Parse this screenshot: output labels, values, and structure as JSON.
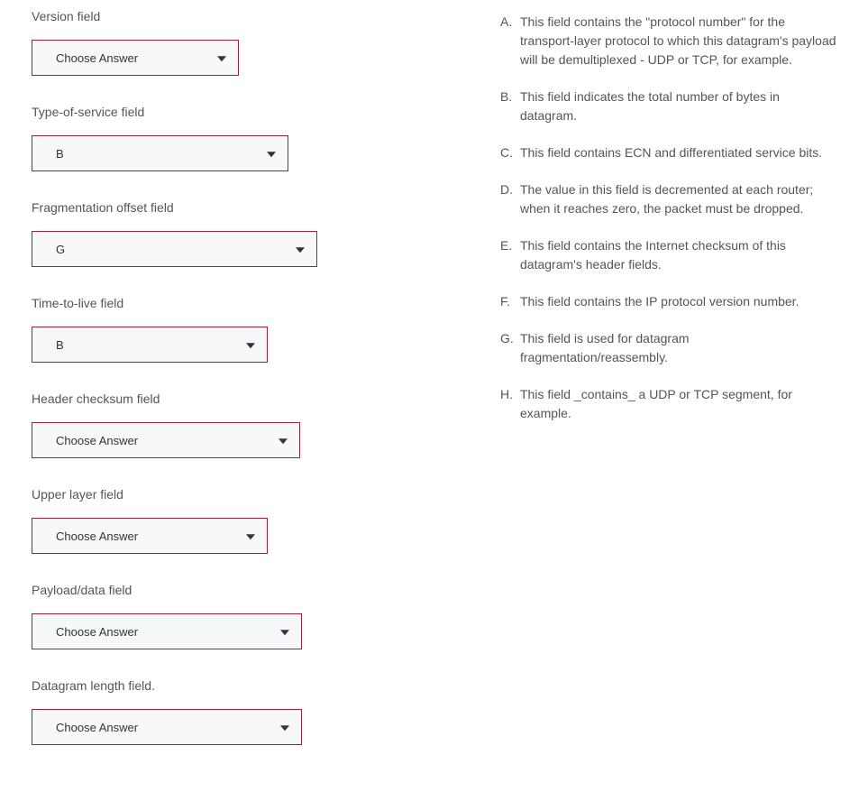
{
  "fields": [
    {
      "label": "Version field",
      "value": "Choose Answer",
      "widthClass": "w230"
    },
    {
      "label": "Type-of-service field",
      "value": "B",
      "widthClass": "w285"
    },
    {
      "label": "Fragmentation offset field",
      "value": "G",
      "widthClass": "w317"
    },
    {
      "label": "Time-to-live field",
      "value": "B",
      "widthClass": "w262"
    },
    {
      "label": "Header checksum field",
      "value": "Choose Answer",
      "widthClass": "w298"
    },
    {
      "label": "Upper layer field",
      "value": "Choose Answer",
      "widthClass": "w262"
    },
    {
      "label": "Payload/data field",
      "value": "Choose Answer",
      "widthClass": "w300"
    },
    {
      "label": "Datagram length field.",
      "value": "Choose Answer",
      "widthClass": "w300"
    }
  ],
  "answers": [
    {
      "letter": "A.",
      "text": "This field contains the \"protocol number\" for the transport-layer protocol to which this datagram's payload will be demultiplexed - UDP or TCP, for example."
    },
    {
      "letter": "B.",
      "text": "This field indicates the total number of bytes in datagram."
    },
    {
      "letter": "C.",
      "text": "This field contains ECN and differentiated service bits."
    },
    {
      "letter": "D.",
      "text": "The value in this field is decremented at each router; when it reaches zero, the packet must be dropped."
    },
    {
      "letter": "E.",
      "text": "This field contains the Internet checksum of this datagram's header fields."
    },
    {
      "letter": "F.",
      "text": "This field contains the IP protocol version number."
    },
    {
      "letter": "G.",
      "text": "This field is used for datagram fragmentation/reassembly."
    },
    {
      "letter": "H.",
      "text": "This field _contains_ a UDP or TCP segment, for example."
    }
  ]
}
